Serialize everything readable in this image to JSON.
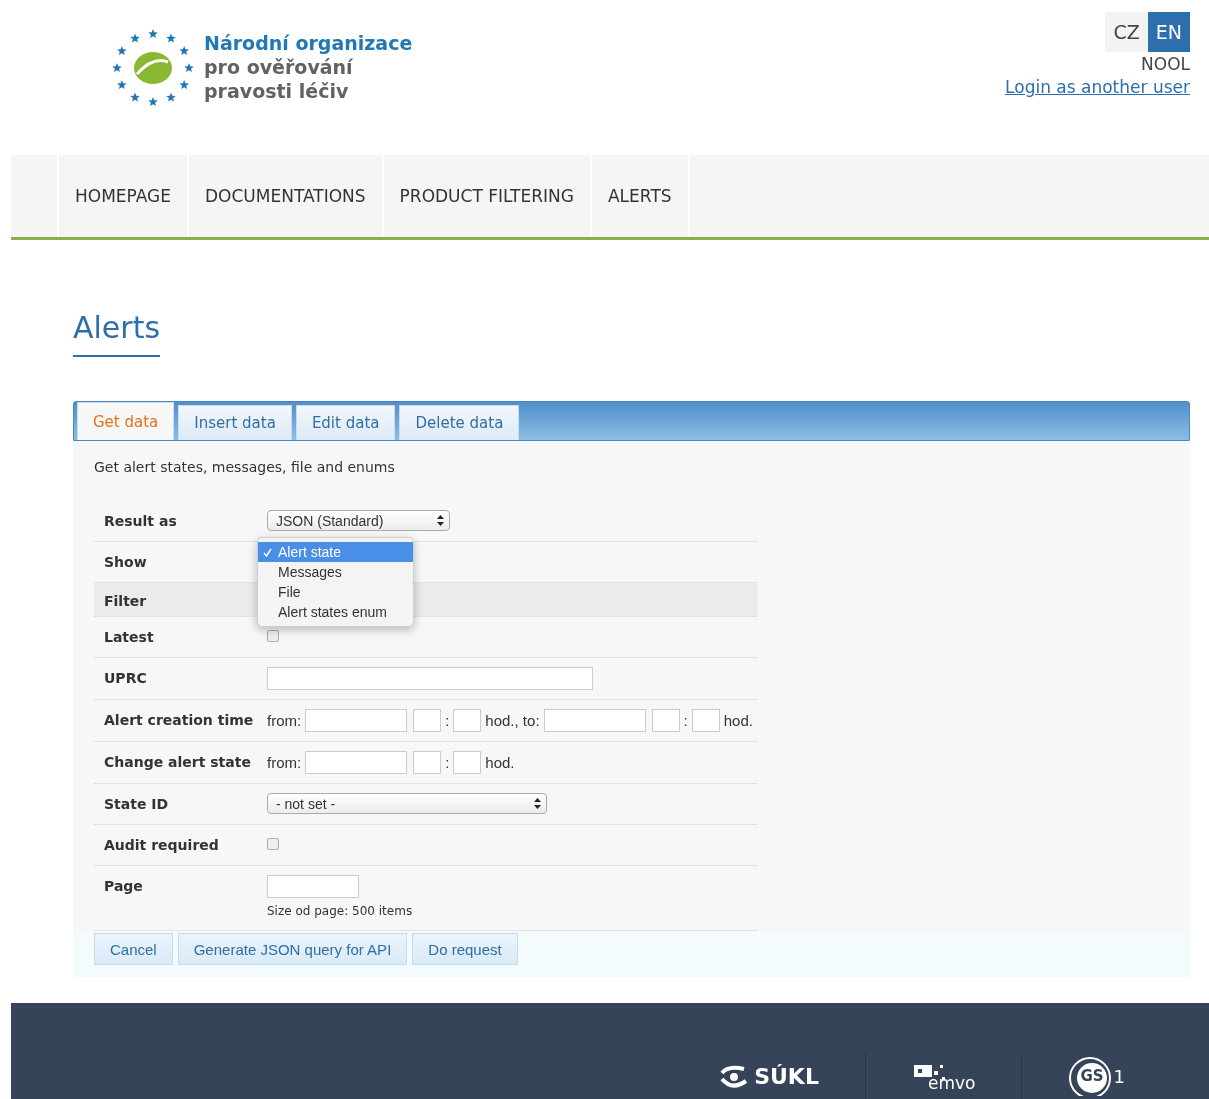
{
  "header": {
    "logo_lines": [
      "Národní organizace",
      "pro ověřování",
      "pravosti léčiv"
    ],
    "languages": [
      {
        "label": "CZ",
        "selected": false
      },
      {
        "label": "EN",
        "selected": true
      }
    ],
    "user": "NOOL",
    "login_link": "Login as another user"
  },
  "nav": [
    "HOMEPAGE",
    "DOCUMENTATIONS",
    "PRODUCT FILTERING",
    "ALERTS"
  ],
  "page_title": "Alerts",
  "tabs": [
    {
      "label": "Get data",
      "selected": true
    },
    {
      "label": "Insert data",
      "selected": false
    },
    {
      "label": "Edit data",
      "selected": false
    },
    {
      "label": "Delete data",
      "selected": false
    }
  ],
  "description": "Get alert states, messages, file and enums",
  "form": [
    {
      "kind": "select",
      "label": "Result as",
      "value": "JSON (Standard)"
    },
    {
      "kind": "dropdown",
      "label": "Show",
      "options": [
        {
          "label": "Alert state",
          "selected": true
        },
        {
          "label": "Messages",
          "selected": false
        },
        {
          "label": "File",
          "selected": false
        },
        {
          "label": "Alert states enum",
          "selected": false
        }
      ]
    },
    {
      "kind": "section",
      "label": "Filter"
    },
    {
      "kind": "checkbox",
      "label": "Latest",
      "checked": false
    },
    {
      "kind": "text",
      "label": "UPRC"
    },
    {
      "kind": "range",
      "label": "Alert creation time",
      "parts": [
        {
          "kind": "label",
          "text": "from:"
        },
        {
          "kind": "date"
        },
        {
          "kind": "time",
          "separator": ":"
        },
        {
          "kind": "label",
          "text": "hod., to:"
        },
        {
          "kind": "date"
        },
        {
          "kind": "time",
          "separator": ":"
        },
        {
          "kind": "label",
          "text": "hod."
        }
      ]
    },
    {
      "kind": "range",
      "label": "Change alert state",
      "parts": [
        {
          "kind": "label",
          "text": "from:"
        },
        {
          "kind": "date"
        },
        {
          "kind": "time",
          "separator": ":"
        },
        {
          "kind": "label",
          "text": "hod."
        }
      ]
    },
    {
      "kind": "long_select",
      "label": "State ID",
      "value": "- not set -"
    },
    {
      "kind": "checkbox",
      "label": "Audit required",
      "checked": false
    },
    {
      "kind": "number",
      "label": "Page",
      "hint": "Size od page: 500 items"
    }
  ],
  "buttons": [
    "Cancel",
    "Generate JSON query for API",
    "Do request"
  ],
  "footer": {
    "logos": [
      {
        "kind": "sukl",
        "text": "SÚKL"
      },
      {
        "kind": "emvo",
        "text": "emvo"
      },
      {
        "kind": "gs1",
        "text": "GS",
        "suffix": "1"
      }
    ]
  }
}
